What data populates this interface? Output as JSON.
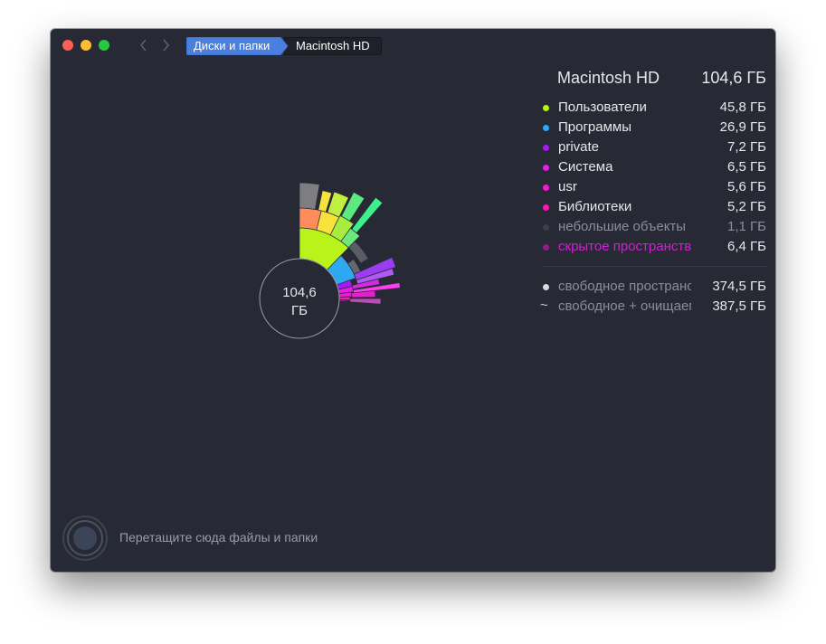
{
  "window": {
    "breadcrumb": [
      {
        "label": "Диски и папки"
      },
      {
        "label": "Macintosh HD"
      }
    ]
  },
  "chart_center": {
    "value": "104,6",
    "unit": "ГБ"
  },
  "info": {
    "title": "Macintosh HD",
    "total": "104,6 ГБ",
    "items": [
      {
        "label": "Пользователи",
        "value": "45,8 ГБ",
        "color": "#b8f31a"
      },
      {
        "label": "Программы",
        "value": "26,9 ГБ",
        "color": "#2fa8f2"
      },
      {
        "label": "private",
        "value": "7,2 ГБ",
        "color": "#a21bf0"
      },
      {
        "label": "Система",
        "value": "6,5 ГБ",
        "color": "#e51ee8"
      },
      {
        "label": "usr",
        "value": "5,6 ГБ",
        "color": "#f21ad8"
      },
      {
        "label": "Библиотеки",
        "value": "5,2 ГБ",
        "color": "#f51ab0"
      },
      {
        "label": "небольшие объекты",
        "value": "1,1 ГБ",
        "color": "#3d4049"
      },
      {
        "label": "скрытое пространство",
        "value": "6,4 ГБ",
        "color": "#8a1e8a"
      }
    ],
    "free": [
      {
        "label": "свободное пространство",
        "value": "374,5 ГБ",
        "color": "#d9dbe0"
      },
      {
        "label": "свободное + очищаемое",
        "value": "387,5 ГБ",
        "icon": "tilde-icon"
      }
    ]
  },
  "drop_zone": {
    "text": "Перетащите сюда файлы и папки"
  }
}
